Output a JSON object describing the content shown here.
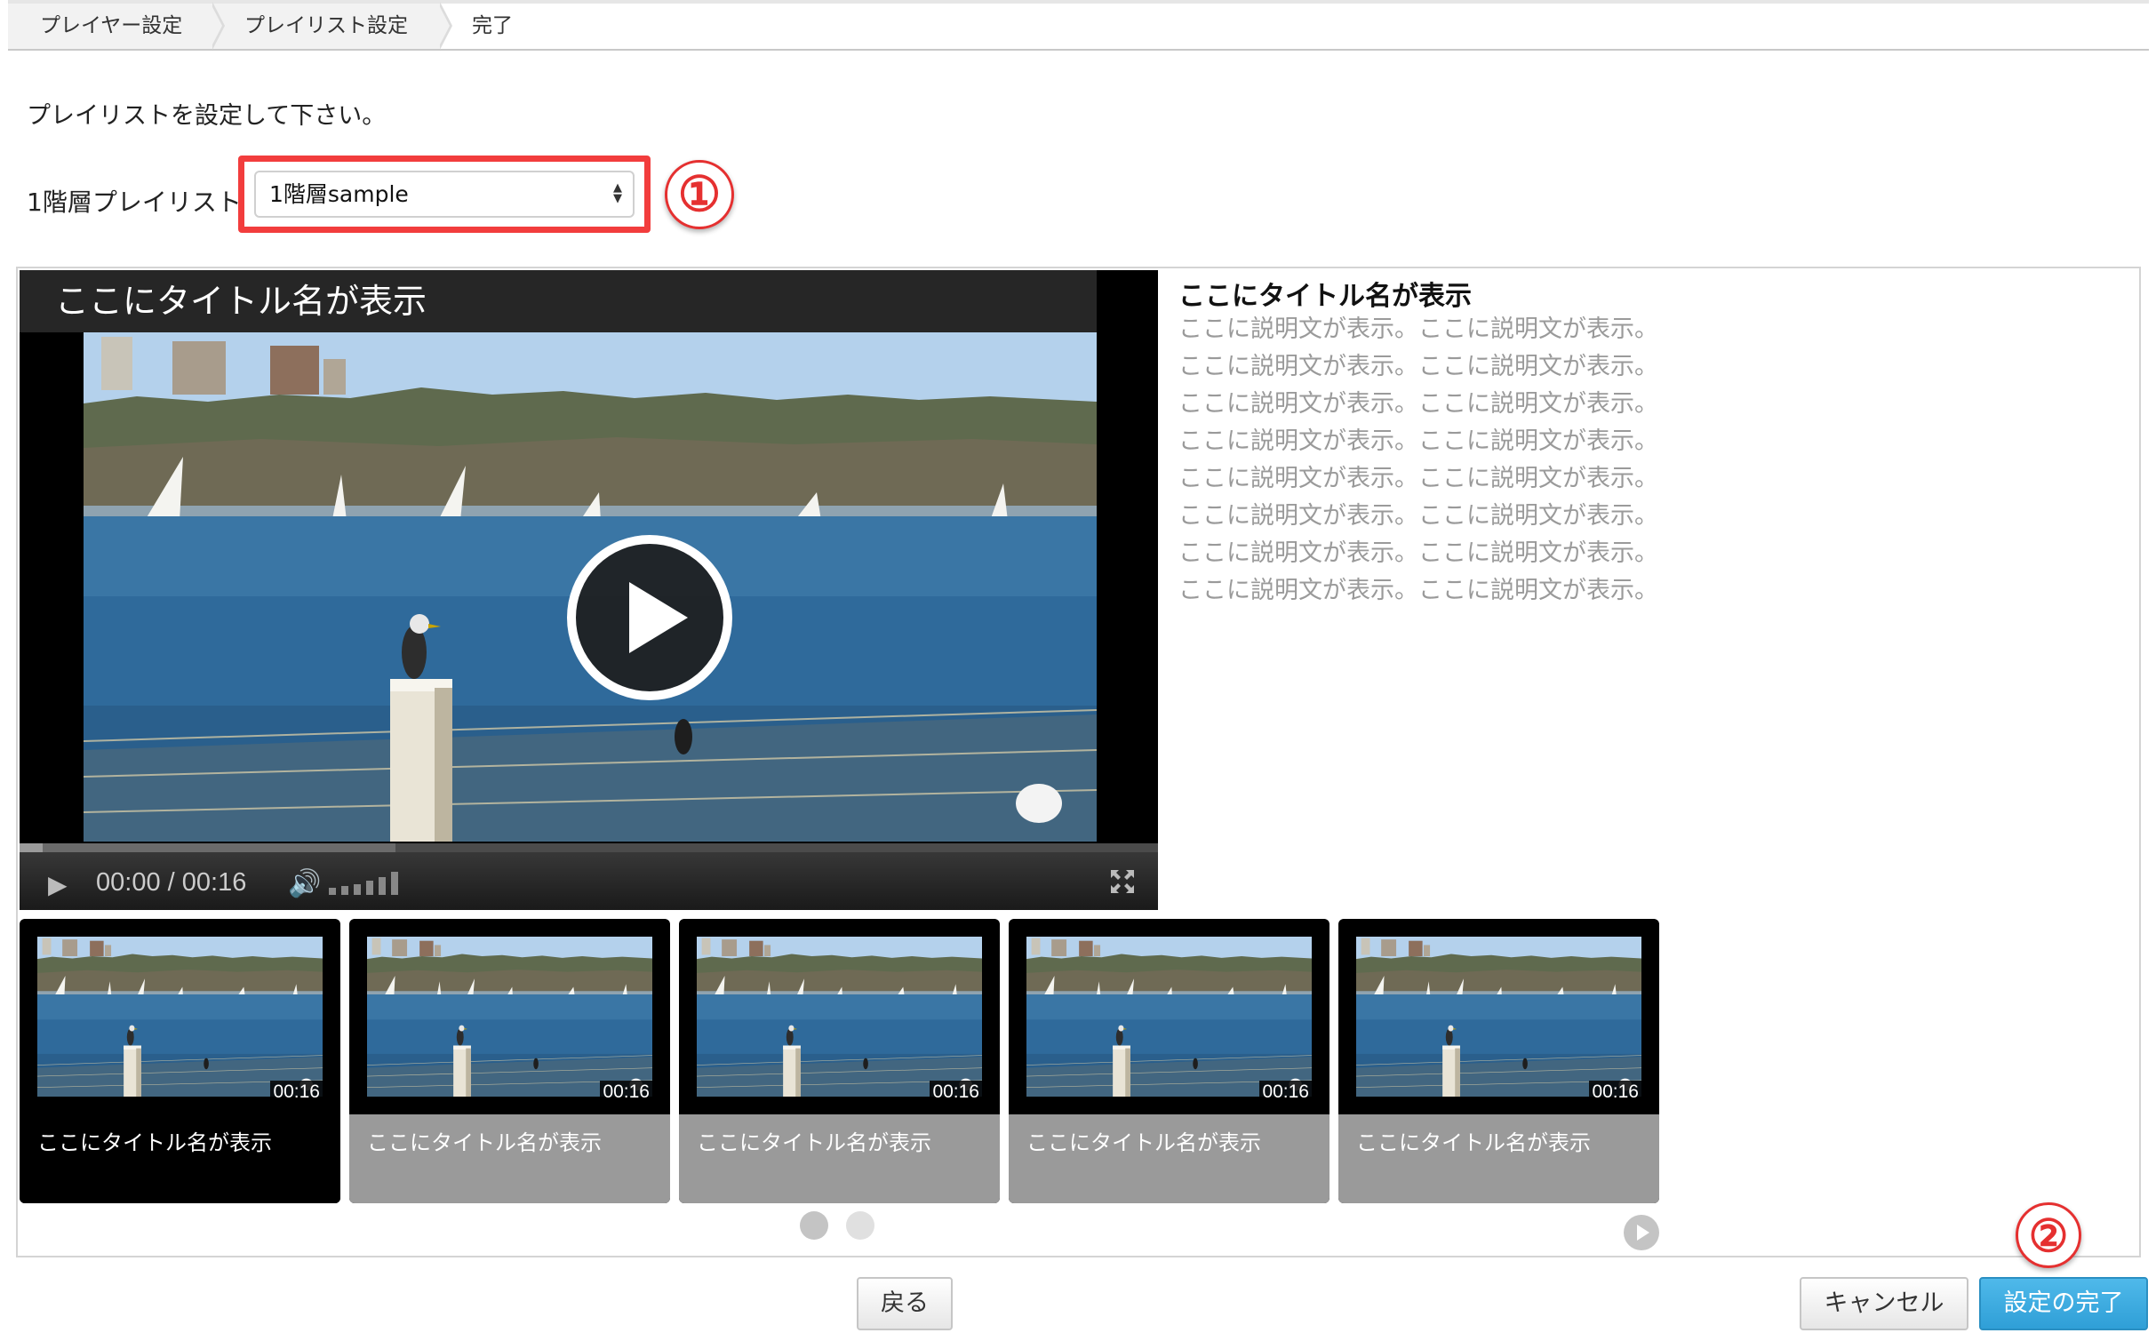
{
  "breadcrumb": [
    {
      "label": "プレイヤー設定"
    },
    {
      "label": "プレイリスト設定"
    },
    {
      "label": "完了"
    }
  ],
  "instruction": "プレイリストを設定して下さい。",
  "playlist_field": {
    "label": "1階層プレイリスト",
    "selected": "1階層sample",
    "step_marker": "①"
  },
  "player": {
    "title": "ここにタイトル名が表示",
    "current_time": "00:00",
    "separator": "/",
    "duration": "00:16",
    "progress_fraction": 0.0
  },
  "side": {
    "title": "ここにタイトル名が表示",
    "description": "ここに説明文が表示。ここに説明文が表示。ここに説明文が表示。ここに説明文が表示。ここに説明文が表示。ここに説明文が表示。ここに説明文が表示。ここに説明文が表示。ここに説明文が表示。ここに説明文が表示。ここに説明文が表示。ここに説明文が表示。ここに説明文が表示。ここに説明文が表示。ここに説明文が表示。ここに説明文が表示。"
  },
  "playlist": {
    "items": [
      {
        "title": "ここにタイトル名が表示",
        "duration": "00:16",
        "active": true
      },
      {
        "title": "ここにタイトル名が表示",
        "duration": "00:16",
        "active": false
      },
      {
        "title": "ここにタイトル名が表示",
        "duration": "00:16",
        "active": false
      },
      {
        "title": "ここにタイトル名が表示",
        "duration": "00:16",
        "active": false
      },
      {
        "title": "ここにタイトル名が表示",
        "duration": "00:16",
        "active": false
      }
    ],
    "pages": 2,
    "current_page": 1
  },
  "footer": {
    "back_label": "戻る",
    "cancel_label": "キャンセル",
    "finish_label": "設定の完了",
    "step_marker": "②"
  },
  "colors": {
    "highlight_red": "#f23d3d",
    "primary_button": "#3aaae0"
  }
}
